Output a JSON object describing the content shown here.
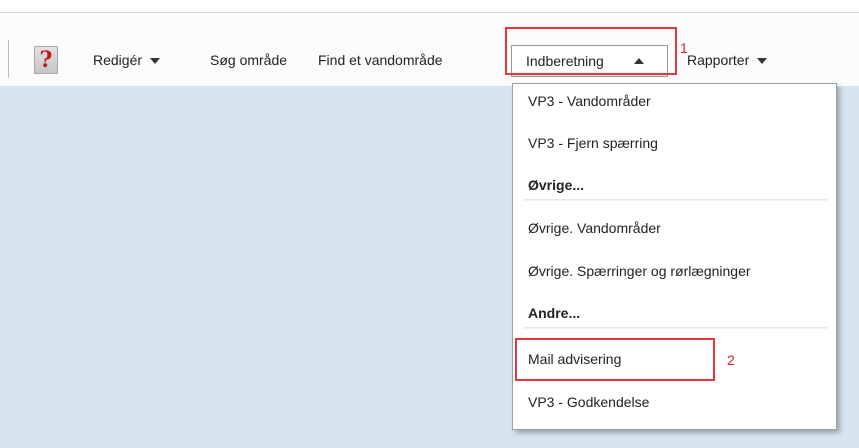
{
  "toolbar": {
    "help_icon": "?",
    "items": [
      {
        "label": "Redigér"
      },
      {
        "label": "Søg område"
      },
      {
        "label": "Find et vandområde"
      },
      {
        "label": "Indberetning"
      },
      {
        "label": "Rapporter"
      }
    ]
  },
  "dropdown": {
    "items": [
      {
        "label": "VP3 - Vandområder"
      },
      {
        "label": "VP3 - Fjern spærring"
      },
      {
        "label": "Øvrige..."
      },
      {
        "label": "Øvrige. Vandområder"
      },
      {
        "label": "Øvrige. Spærringer og rørlægninger"
      },
      {
        "label": "Andre..."
      },
      {
        "label": "Mail advisering"
      },
      {
        "label": "VP3 - Godkendelse"
      }
    ]
  },
  "annotations": {
    "marker_1": "1",
    "marker_2": "2"
  },
  "colors": {
    "highlight": "#e8383d",
    "canvas": "#d6e5ef",
    "help_icon": "#c8171b"
  }
}
